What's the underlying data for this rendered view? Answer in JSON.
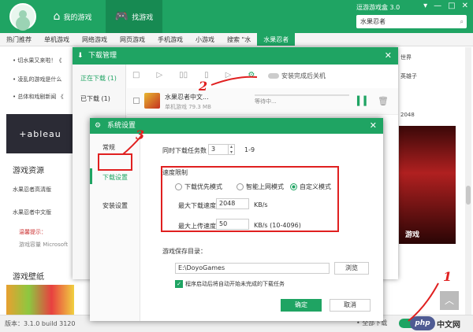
{
  "topbar": {
    "tabs": [
      {
        "label": "我的游戏",
        "icon": "home-icon"
      },
      {
        "label": "找游戏",
        "icon": "gamepad-icon"
      }
    ],
    "version": "逗游游戏盒 3.0",
    "search": {
      "value": "水果忍者",
      "icon": "search-icon"
    },
    "window_buttons": [
      "▾",
      "—",
      "□",
      "✕"
    ]
  },
  "categories": [
    "热门推荐",
    "单机游戏",
    "网络游戏",
    "网页游戏",
    "手机游戏",
    "小游戏",
    "搜索 \"水",
    "水果忍者"
  ],
  "left": {
    "lines": [
      "• 切水果又来啦！《",
      "• 凌乱的游戏是什么",
      "• 总体和戏剧新闻 《"
    ],
    "tableau": "+ableau",
    "section_resources": "游戏资源",
    "res1": "水果忍者高清版",
    "res2": "水果忍者中文版",
    "tip_title": "温馨提示：",
    "tip_body": "游戏容量 Microsoft",
    "section_wallpaper": "游戏壁纸"
  },
  "right": {
    "lines": [
      "世界",
      "英雄子",
      "2048"
    ],
    "poster_text": "游戏"
  },
  "status": {
    "version": "版本：3.1.0 build 3120",
    "right_text": "• 全部下载"
  },
  "php_badge": "php",
  "php_text": "中文网",
  "download_manager": {
    "title": "下载管理",
    "close": "✕",
    "side": [
      "正在下载 (1)",
      "已下载 (1)"
    ],
    "toolbar": [
      "□",
      "▷",
      "▯▯",
      "▯",
      "▷",
      "⚙"
    ],
    "shutdown_label": "安装完成后关机",
    "row": {
      "name": "水果忍者中文...",
      "info": "单机游戏 79.3 MB",
      "status": "等待中...",
      "pause": "▍▍",
      "delete": "🗑"
    }
  },
  "settings": {
    "title": "系统设置",
    "close": "✕",
    "side": [
      "常规",
      "下载设置",
      "安装设置"
    ],
    "max_tasks_label": "同时下载任务数",
    "max_tasks_value": "3",
    "max_tasks_range": "1-9",
    "speed_title": "速度限制",
    "modes": [
      "下载优先模式",
      "智能上网模式",
      "自定义模式"
    ],
    "max_down_label": "最大下载速度",
    "max_down_value": "2048",
    "max_down_unit": "KB/s",
    "max_up_label": "最大上传速度",
    "max_up_value": "50",
    "max_up_unit": "KB/s (10-4096)",
    "save_dir_label": "游戏保存目录：",
    "save_dir_value": "E:\\DoyoGames",
    "browse": "浏览",
    "auto_start": "程序启动后将自动开始未完成的下载任务",
    "ok": "确定",
    "cancel": "取消"
  },
  "annotations": [
    "1",
    "2",
    "3"
  ]
}
